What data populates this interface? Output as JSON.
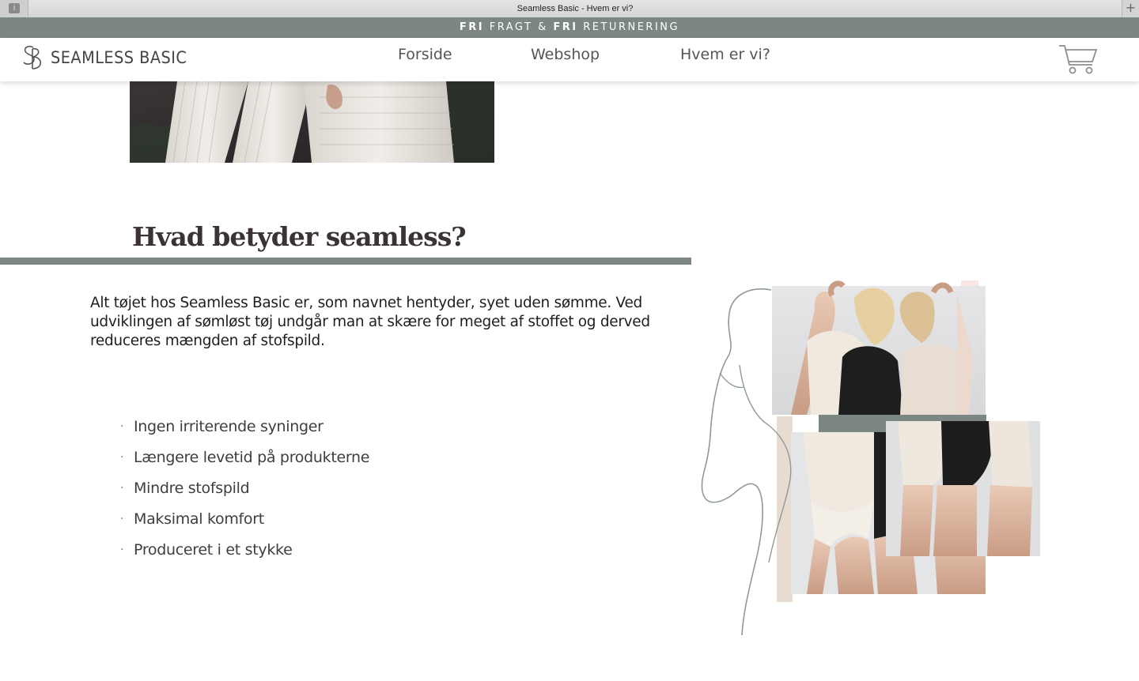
{
  "browser": {
    "tab_title": "Seamless Basic - Hvem er vi?",
    "add_tab_glyph": "+",
    "sidebar_toggle_glyph": "i"
  },
  "promo": {
    "word1": "FRI",
    "text1": " FRAGT & ",
    "word2": "FRI",
    "text2": " RETURNERING"
  },
  "header": {
    "brand": "SEAMLESS BASIC",
    "nav": [
      {
        "label": "Forside"
      },
      {
        "label": "Webshop"
      },
      {
        "label": "Hvem er vi?"
      }
    ],
    "cart_icon": "shopping-cart-icon"
  },
  "section": {
    "title": "Hvad betyder seamless?",
    "intro": "Alt tøjet hos Seamless Basic er, som navnet hentyder, syet uden sømme. Ved udviklingen af sømløst tøj undgår man at skære for meget af stoffet og derved reduceres mængden af stofspild.",
    "bullet_glyph": "·",
    "benefits": [
      "Ingen irriterende syninger",
      "Længere levetid på produkterne",
      "Mindre stofspild",
      "Maksimal komfort",
      "Produceret i et stykke"
    ]
  },
  "colors": {
    "accent": "#7b8685",
    "heading": "#3a3233",
    "blush": "#f7e6e2",
    "sand": "#e8dcd0"
  }
}
